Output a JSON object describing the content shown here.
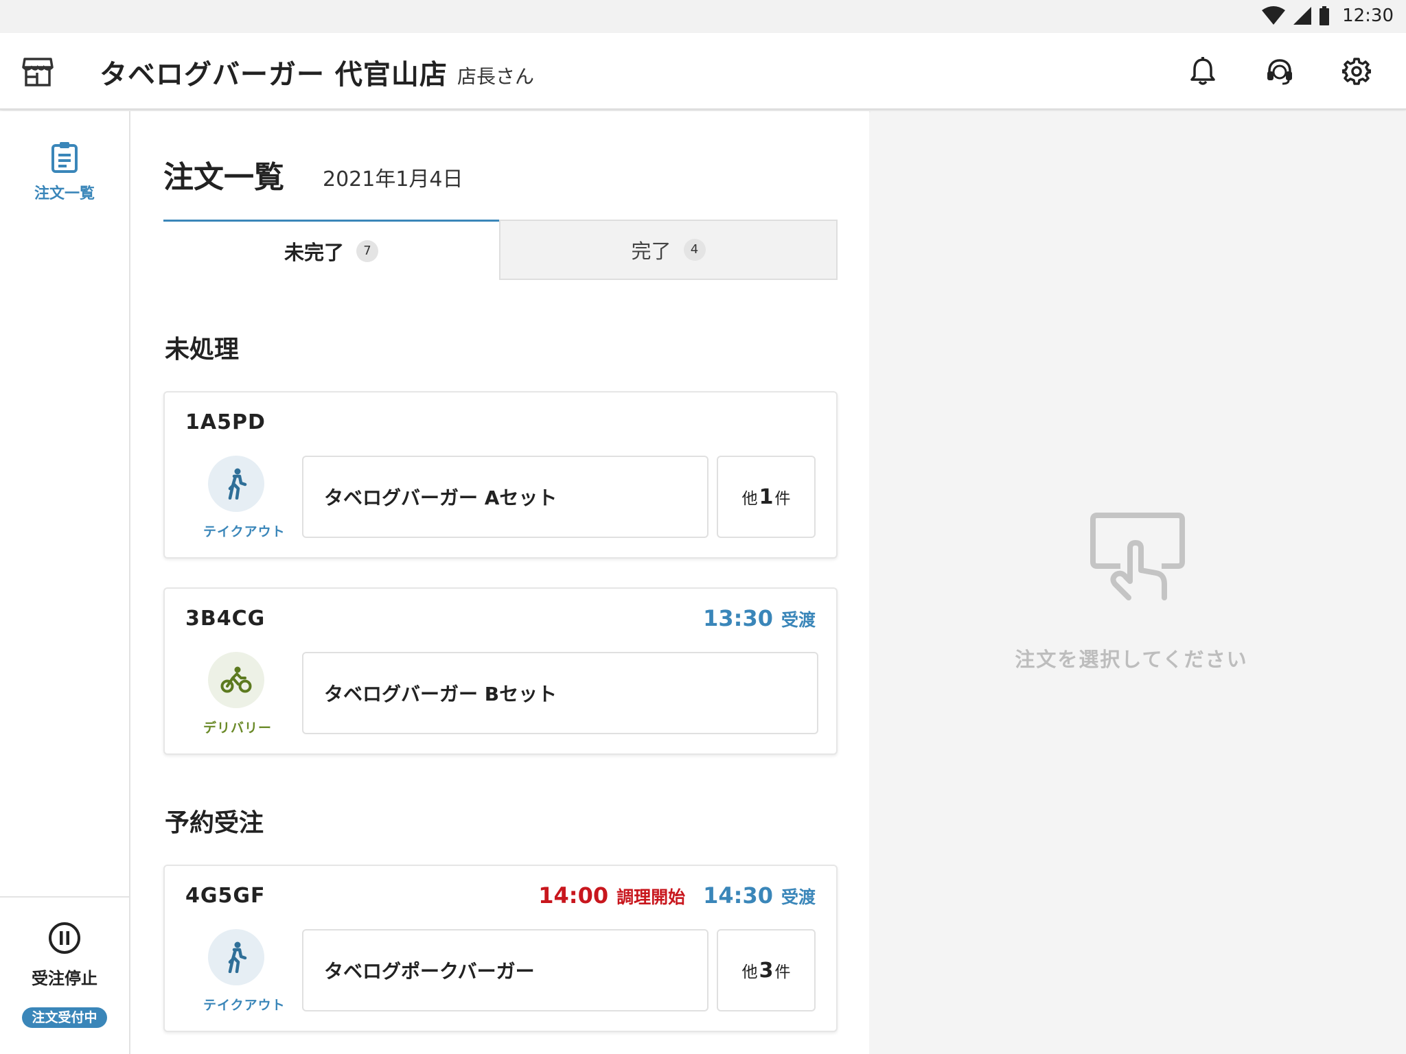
{
  "status_bar": {
    "time": "12:30",
    "icons": [
      "wifi-icon",
      "cell-signal-icon",
      "battery-icon"
    ]
  },
  "app_bar": {
    "title": "タベログバーガー 代官山店",
    "user": "店長さん",
    "actions": [
      "bell-icon",
      "support-headset-icon",
      "gear-icon"
    ]
  },
  "rail": {
    "nav_label": "注文一覧",
    "pause_label": "受注停止",
    "status_pill": "注文受付中"
  },
  "main": {
    "title": "注文一覧",
    "date": "2021年1月4日",
    "tabs": [
      {
        "label": "未完了",
        "count": "7"
      },
      {
        "label": "完了",
        "count": "4"
      }
    ],
    "sections": [
      {
        "title": "未処理"
      },
      {
        "title": "予約受注"
      }
    ],
    "orders": [
      {
        "code": "1A5PD",
        "type_label": "テイクアウト",
        "item": "タベログバーガー Aセット",
        "more_prefix": "他",
        "more_count": "1",
        "more_suffix": "件"
      },
      {
        "code": "3B4CG",
        "type_label": "デリバリー",
        "item": "タベログバーガー Bセット",
        "pickup_time": "13:30",
        "pickup_label": "受渡"
      },
      {
        "code": "4G5GF",
        "type_label": "テイクアウト",
        "item": "タベログポークバーガー",
        "cook_time": "14:00",
        "cook_label": "調理開始",
        "pickup_time": "14:30",
        "pickup_label": "受渡",
        "more_prefix": "他",
        "more_count": "3",
        "more_suffix": "件"
      }
    ]
  },
  "detail": {
    "empty_message": "注文を選択してください"
  },
  "colors": {
    "accent": "#3a86b9",
    "alert": "#c8161d",
    "delivery": "#6a8a28"
  }
}
